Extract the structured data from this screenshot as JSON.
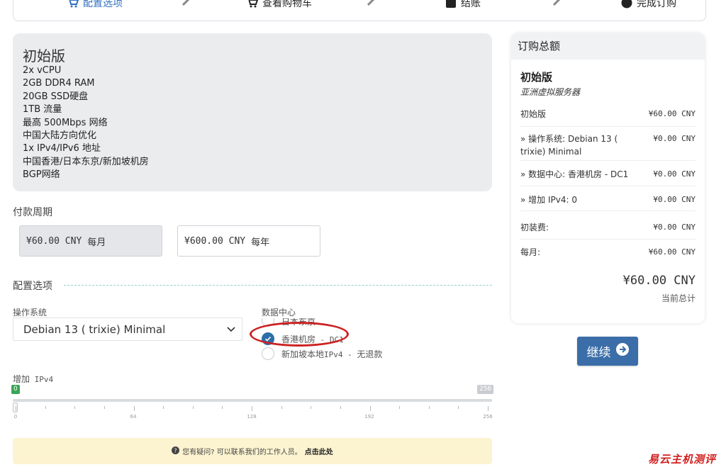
{
  "steps": [
    {
      "label": "配置选项",
      "icon": "cart-plus-icon",
      "active": true
    },
    {
      "label": "查看购物车",
      "icon": "cart-icon",
      "active": false
    },
    {
      "label": "结账",
      "icon": "calculator-icon",
      "active": false
    },
    {
      "label": "完成订购",
      "icon": "check-circle-icon",
      "active": false
    }
  ],
  "product": {
    "name": "初始版",
    "features": [
      "2x vCPU",
      "2GB DDR4 RAM",
      "20GB SSD硬盘",
      "1TB 流量",
      "最高 500Mbps 网络",
      "中国大陆方向优化",
      "1x IPv4/IPv6 地址",
      "中国香港/日本东京/新加坡机房",
      "BGP网络"
    ]
  },
  "billing": {
    "label": "付款周期",
    "options": [
      {
        "price": "¥60.00 CNY",
        "period": "每月",
        "selected": true
      },
      {
        "price": "¥600.00 CNY",
        "period": "每年",
        "selected": false
      }
    ]
  },
  "config": {
    "label": "配置选项",
    "os_label": "操作系统",
    "os_value": "Debian 13 ( trixie) Minimal",
    "dc_label": "数据中心",
    "dc_options": [
      {
        "label": "日本东京",
        "selected": false
      },
      {
        "label": "香港机房",
        "suffix": " - DC1",
        "selected": true
      },
      {
        "label": "新加坡本地",
        "suffix": "IPv4 - ",
        "extra": "无退款",
        "selected": false
      }
    ],
    "ipv4_label": "增加",
    "ipv4_label_mono": " IPv4",
    "ipv4_value": 0,
    "ipv4_max": 256,
    "value_bubble": "0",
    "max_bubble": "256",
    "tick_labels": [
      "0",
      "64",
      "128",
      "192",
      "256"
    ]
  },
  "help": {
    "text": "您有疑问? 可以联系我们的工作人员。",
    "link": "点击此处"
  },
  "summary": {
    "title": "订购总额",
    "product": "初始版",
    "group": "亚洲虚拟服务器",
    "rows": [
      {
        "label": "初始版",
        "value": "¥60.00 CNY"
      },
      {
        "label": "» 操作系统: Debian 13 ( trixie) Minimal",
        "value": "¥0.00 CNY"
      },
      {
        "label": "» 数据中心: 香港机房 - DC1",
        "value": "¥0.00 CNY"
      },
      {
        "label": "» 增加 IPv4: 0",
        "value": "¥0.00 CNY"
      },
      {
        "label": "初装费:",
        "value": "¥0.00 CNY"
      },
      {
        "label": "每月:",
        "value": "¥60.00 CNY"
      }
    ],
    "total": "¥60.00 CNY",
    "total_label": "当前总计"
  },
  "continue_label": "继续",
  "watermark": "易云主机测评",
  "colors": {
    "accent": "#3b6ea8",
    "highlight": "#cc2222",
    "green": "#3aa655"
  }
}
